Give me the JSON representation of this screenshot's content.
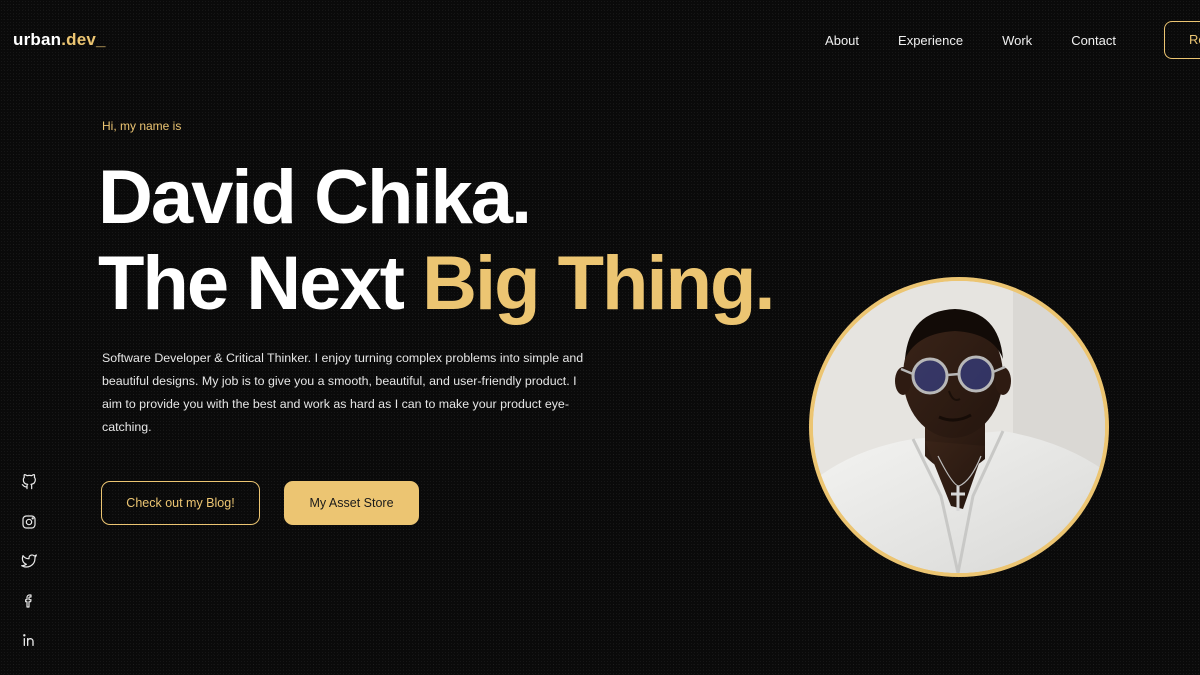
{
  "nav": {
    "logo_main": "urban",
    "logo_accent": ".dev_",
    "links": [
      "About",
      "Experience",
      "Work",
      "Contact"
    ],
    "resume_label": "Resume"
  },
  "hero": {
    "intro": "Hi, my name is",
    "name": "David Chika.",
    "tagline_lead": "The Next ",
    "tagline_accent": "Big Thing.",
    "bio": "Software Developer & Critical Thinker. I enjoy turning complex problems into simple and beautiful designs. My job is to give you a smooth, beautiful, and user-friendly product. I aim to provide you with the best and work as hard as I can to make your product eye-catching.",
    "blog_button": "Check out my Blog!",
    "store_button": "My Asset Store"
  },
  "socials": [
    {
      "icon": "github-icon"
    },
    {
      "icon": "instagram-icon"
    },
    {
      "icon": "twitter-icon"
    },
    {
      "icon": "facebook-icon"
    },
    {
      "icon": "linkedin-icon"
    }
  ],
  "colors": {
    "background": "#0a0a0a",
    "accent": "#ecc572",
    "text": "#ffffff"
  }
}
